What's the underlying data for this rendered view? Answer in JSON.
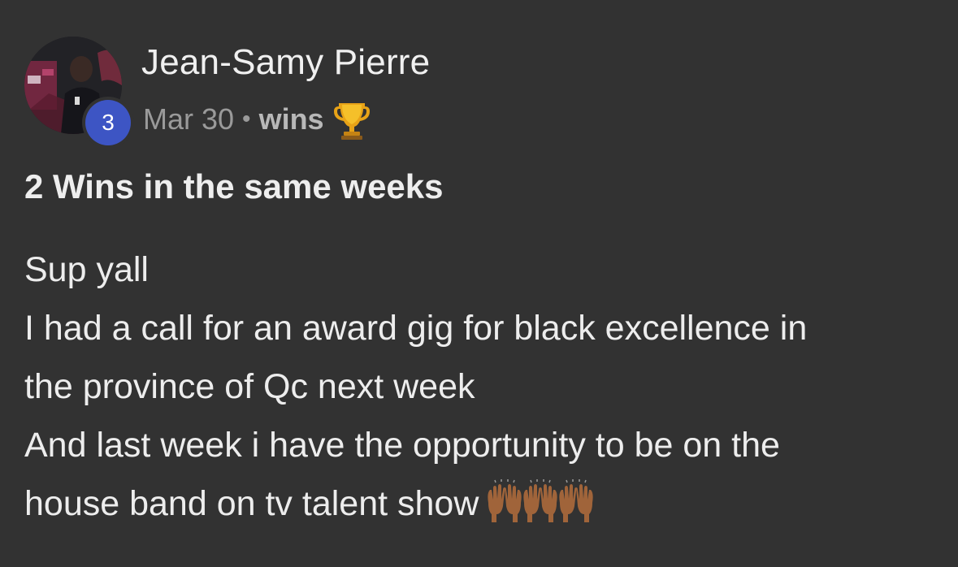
{
  "post": {
    "author": {
      "name": "Jean-Samy Pierre",
      "level": "3",
      "avatar_icon": "user-photo-avatar"
    },
    "meta": {
      "date": "Mar 30",
      "separator": "•",
      "category": "wins",
      "category_icon": "trophy-icon"
    },
    "title": "2 Wins in the same weeks",
    "body": {
      "lines": [
        "Sup yall",
        "I had a call for an award gig for black excellence in",
        "the province of Qc next week",
        "And last week i have the opportunity to be on the",
        "house band on tv talent show"
      ],
      "trailing_emoji": "raising-hands-icon",
      "trailing_emoji_count": 3
    }
  },
  "colors": {
    "background": "#323232",
    "badge": "#3d55c4",
    "text_primary": "#ececec",
    "text_muted": "#9a9a9a"
  }
}
